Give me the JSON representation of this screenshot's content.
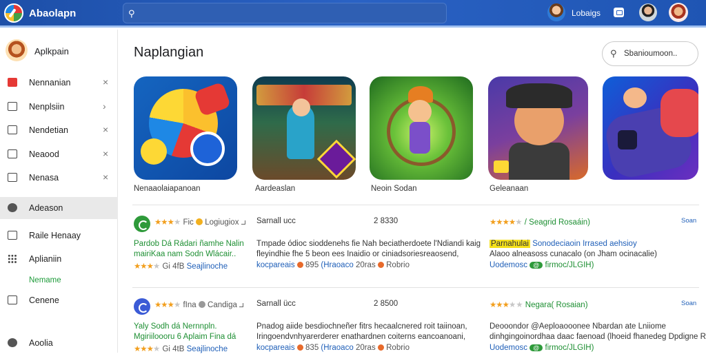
{
  "header": {
    "app_title": "Abaolapn",
    "user_name": "Lobaigs"
  },
  "sidebar": {
    "user_name": "Aplkpain",
    "items": [
      {
        "label": "Nennanian",
        "icon": "red-home-icon"
      },
      {
        "label": "Nenplsiin",
        "icon": "chart-icon"
      },
      {
        "label": "Nendetian",
        "icon": "media-icon"
      },
      {
        "label": "Neaood",
        "icon": "grid-icon"
      },
      {
        "label": "Nenasa",
        "icon": "document-icon"
      },
      {
        "label": "Adeason",
        "icon": "check-circle-icon"
      },
      {
        "label": "Raile Henaay",
        "icon": "edit-icon"
      },
      {
        "label": "Aplianiin",
        "icon": "apps-grid-icon"
      },
      {
        "label": "Nemame",
        "icon": ""
      },
      {
        "label": "Cenene",
        "icon": "calendar-icon"
      },
      {
        "label": "Aoolia",
        "icon": "user-icon"
      }
    ]
  },
  "main": {
    "title": "Naplangian",
    "sort_placeholder": "Sbanioumoon..",
    "tiles": [
      {
        "label": "Nenaaolaiapanoan"
      },
      {
        "label": "Aardeaslan"
      },
      {
        "label": "Neoin Sodan"
      },
      {
        "label": "Geleanaan"
      },
      {
        "label": ""
      }
    ]
  },
  "rows": [
    {
      "meta_stars": "★★★",
      "meta_text": "Fic",
      "meta_extra": "Logiugiox",
      "title_line1": "Pardob Dá Rádari ñamhe Nalin",
      "title_line2": "mairiKaa nam Sodn Wlácair..",
      "foot_stars": "★★★",
      "foot_num": "Gi 4fB",
      "foot_link": "Seajlinoche",
      "col2": "Sarnall ucc",
      "col3": "2 8330",
      "desc_line1": "Tmpade ódioc sioddenehs fie Nah  beciatherdoete l'Ndiandi kaig",
      "desc_line2": "fleyindhie fhe 5 beon ees Inaidio or ciniadsoriesreaosend,",
      "sub_text": "kocpareais",
      "sub_num": "895",
      "sub_link": "(Hraoaco",
      "sub_tail": "20ras",
      "sub_tail2": "Robrio",
      "right_stars": "★★★★",
      "right_text": "/ Seagrid Rosaáin)",
      "right_hl": "Parnahulai",
      "right_green": "Sonodeciaoin Irrased aehsioy",
      "right_line2": "Alaoo alneasoss  cunacalo (on Jham ocinacalie)",
      "right_foot": "Uodemosc",
      "right_pill": "@",
      "right_foot2": "firmoc/JLGIH)",
      "link": "Soan"
    },
    {
      "meta_stars": "★★★",
      "meta_text": "fIna",
      "meta_extra": "Candiga",
      "title_line1": "Yaly Sodh dá Nernnpln.",
      "title_line2": "Mgiriiloooru 6 Aplaim  Fina dá",
      "foot_stars": "★★★",
      "foot_num": "Gi 4tB",
      "foot_link": "Seajlinoche",
      "col2": "Sarnall ücc",
      "col3": "2 8500",
      "desc_line1": "Pnadog aiide besdiochneñer fitrs hecaalcnered roit taiinoan,",
      "desc_line2": "Iringoendvnhyarerderer enathardnen coiterns eancoanoani,",
      "sub_text": "kocpareais",
      "sub_num": "835",
      "sub_link": "(Hraoaco",
      "sub_tail": "20ras",
      "sub_tail2": "Robrio",
      "right_stars": "★★★",
      "right_text": "Negara( Rosaian)",
      "right_hl": "",
      "right_green": "",
      "right_line2": "Deooondor  @Aeploaooonee Nbardan ate Lniiome",
      "right_line3": "dinhgingoinordhaa daac faenoad (lhoeid fhanedeg Dpdigne RaIlD)",
      "right_foot": "Uodemosc",
      "right_pill": "@",
      "right_foot2": "firmoc/JLGIH)",
      "link": "Soan"
    }
  ]
}
